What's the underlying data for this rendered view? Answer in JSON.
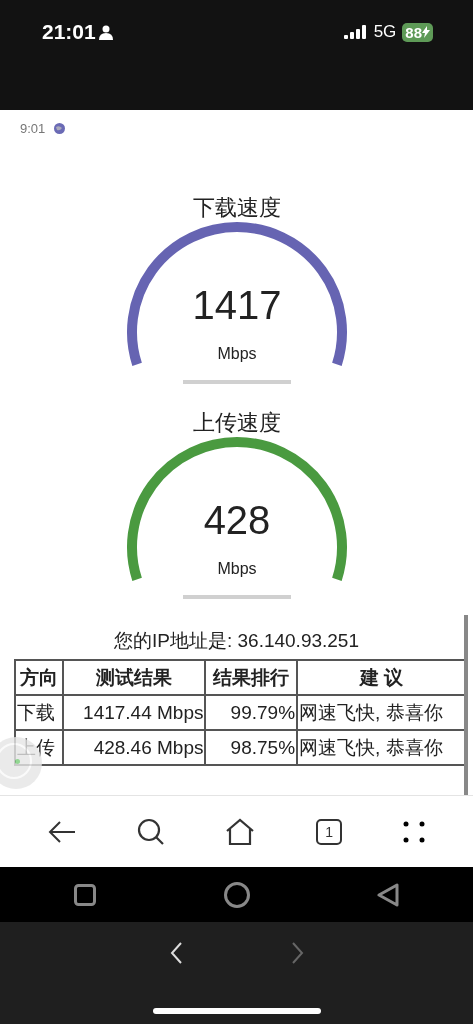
{
  "status_bar": {
    "time": "21:01",
    "network": "5G",
    "battery": "88"
  },
  "page": {
    "time": "9:01",
    "gauges": [
      {
        "title": "下载速度",
        "value": "1417",
        "unit": "Mbps",
        "color": "#6664b2"
      },
      {
        "title": "上传速度",
        "value": "428",
        "unit": "Mbps",
        "color": "#4a9a40"
      }
    ],
    "ip_text": "您的IP地址是: 36.140.93.251",
    "table": {
      "columns": [
        "方向",
        "测试结果",
        "结果排行",
        "建 议"
      ],
      "rows": [
        [
          "下载",
          "1417.44 Mbps",
          "99.79%",
          "网速飞快, 恭喜你"
        ],
        [
          "上传",
          "428.46 Mbps",
          "98.75%",
          "网速飞快, 恭喜你"
        ]
      ]
    }
  },
  "browser_toolbar": {
    "tab_count": "1"
  }
}
